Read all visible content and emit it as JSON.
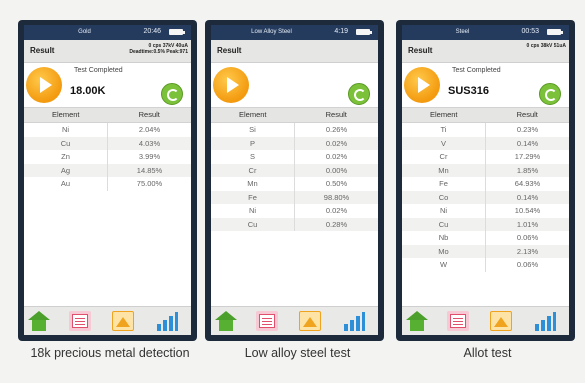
{
  "screens": [
    {
      "status_mode": "Gold",
      "status_time": "20:46",
      "result_label": "Result",
      "info_line1": "0 cps 37kV 40uA",
      "info_line2": "Deadtime:0.5% Peak:971",
      "status_text": "Test Completed",
      "grade": "18.00K",
      "col_element": "Element",
      "col_result": "Result",
      "rows": [
        {
          "el": "Ni",
          "val": "2.04%"
        },
        {
          "el": "Cu",
          "val": "4.03%"
        },
        {
          "el": "Zn",
          "val": "3.99%"
        },
        {
          "el": "Ag",
          "val": "14.85%"
        },
        {
          "el": "Au",
          "val": "75.00%"
        }
      ],
      "caption": "18k precious metal detection"
    },
    {
      "status_mode": "Low Alloy Steel",
      "status_time": "4:19",
      "result_label": "Result",
      "info_line1": "",
      "info_line2": "",
      "status_text": "",
      "grade": "",
      "col_element": "Element",
      "col_result": "Result",
      "rows": [
        {
          "el": "Si",
          "val": "0.26%"
        },
        {
          "el": "P",
          "val": "0.02%"
        },
        {
          "el": "S",
          "val": "0.02%"
        },
        {
          "el": "Cr",
          "val": "0.00%"
        },
        {
          "el": "Mn",
          "val": "0.50%"
        },
        {
          "el": "Fe",
          "val": "98.80%"
        },
        {
          "el": "Ni",
          "val": "0.02%"
        },
        {
          "el": "Cu",
          "val": "0.28%"
        }
      ],
      "caption": "Low alloy steel test"
    },
    {
      "status_mode": "Steel",
      "status_time": "00:53",
      "result_label": "Result",
      "info_line1": "0 cps 38kV 51uA",
      "info_line2": "",
      "status_text": "Test Completed",
      "grade": "SUS316",
      "col_element": "Element",
      "col_result": "Result",
      "rows": [
        {
          "el": "Ti",
          "val": "0.23%"
        },
        {
          "el": "V",
          "val": "0.14%"
        },
        {
          "el": "Cr",
          "val": "17.29%"
        },
        {
          "el": "Mn",
          "val": "1.85%"
        },
        {
          "el": "Fe",
          "val": "64.93%"
        },
        {
          "el": "Co",
          "val": "0.14%"
        },
        {
          "el": "Ni",
          "val": "10.54%"
        },
        {
          "el": "Cu",
          "val": "1.01%"
        },
        {
          "el": "Nb",
          "val": "0.06%"
        },
        {
          "el": "Mo",
          "val": "2.13%"
        },
        {
          "el": "W",
          "val": "0.06%"
        }
      ],
      "caption": "Allot test"
    }
  ]
}
